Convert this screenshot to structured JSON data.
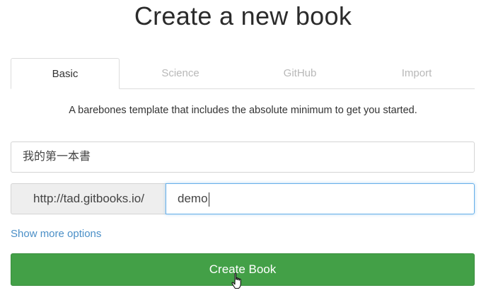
{
  "page": {
    "title": "Create a new book"
  },
  "tabs": [
    {
      "label": "Basic",
      "active": true
    },
    {
      "label": "Science",
      "active": false
    },
    {
      "label": "GitHub",
      "active": false
    },
    {
      "label": "Import",
      "active": false
    }
  ],
  "description": "A barebones template that includes the absolute minimum to get you started.",
  "form": {
    "book_title_value": "我的第一本書",
    "url_prefix": "http://tad.gitbooks.io/",
    "url_slug_value": "demo",
    "show_more_label": "Show more options",
    "create_button_label": "Create Book"
  },
  "colors": {
    "primary_green": "#43a047",
    "link_blue": "#4a8fc7",
    "focus_blue": "#66afe9"
  },
  "icons": {
    "cursor": "hand-pointer-icon"
  }
}
